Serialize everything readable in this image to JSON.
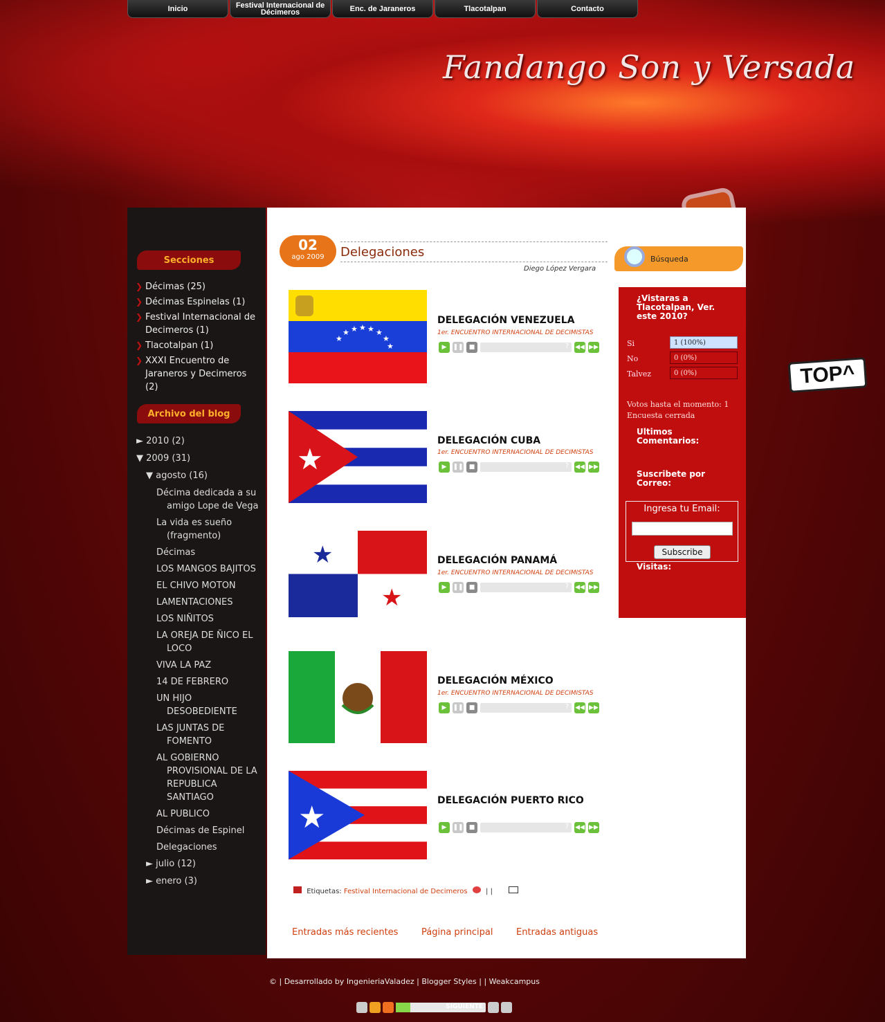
{
  "nav": {
    "items": [
      {
        "label": "Inicio"
      },
      {
        "label": "Festival Internacional de Décimeros"
      },
      {
        "label": "Enc. de Jaraneros"
      },
      {
        "label": "Tlacotalpan"
      },
      {
        "label": "Contacto"
      }
    ]
  },
  "header": {
    "site_title": "Fandango Son y Versada"
  },
  "sidebar": {
    "secciones_title": "Secciones",
    "secciones": [
      {
        "label": "Décimas (25)"
      },
      {
        "label": "Décimas Espinelas (1)"
      },
      {
        "label": "Festival Internacional de Decimeros (1)"
      },
      {
        "label": "Tlacotalpan (1)"
      },
      {
        "label": "XXXI Encuentro de Jaraneros y Decimeros (2)"
      }
    ],
    "archivo_title": "Archivo del blog",
    "archive": {
      "y2010": "► 2010 (2)",
      "y2009": "▼ 2009 (31)",
      "agosto": "▼ agosto (16)",
      "posts": [
        "Décima dedicada a su amigo Lope de Vega",
        "La vida es sueño (fragmento)",
        "Décimas",
        "LOS MANGOS BAJITOS",
        "EL CHIVO MOTON",
        "LAMENTACIONES",
        "LOS NIÑITOS",
        "LA OREJA DE ÑICO EL LOCO",
        "VIVA LA PAZ",
        "14 DE FEBRERO",
        "UN HIJO DESOBEDIENTE",
        "LAS JUNTAS DE FOMENTO",
        "AL GOBIERNO PROVISIONAL DE LA REPUBLICA SANTIAGO",
        "AL PUBLICO",
        "Décimas de Espinel",
        "Delegaciones"
      ],
      "julio": "► julio (12)",
      "enero": "► enero (3)"
    }
  },
  "post": {
    "date_day": "02",
    "date_month_year": "ago 2009",
    "title": "Delegaciones",
    "author": "Diego López Vergara",
    "delegations": [
      {
        "name": "DELEGACIÓN VENEZUELA",
        "subtitle": "1er. ENCUENTRO INTERNACIONAL DE DECIMISTAS"
      },
      {
        "name": "DELEGACIÓN CUBA",
        "subtitle": "1er. ENCUENTRO INTERNACIONAL DE DECIMISTAS"
      },
      {
        "name": "DELEGACIÓN PANAMÁ",
        "subtitle": "1er. ENCUENTRO INTERNACIONAL DE DECIMISTAS"
      },
      {
        "name": "DELEGACIÓN MÉXICO",
        "subtitle": "1er. ENCUENTRO INTERNACIONAL DE DECIMISTAS"
      },
      {
        "name": "DELEGACIÓN PUERTO RICO",
        "subtitle": ""
      }
    ],
    "player_unknown": "?",
    "labels_prefix": "Etiquetas:",
    "labels_link": "Festival Internacional de Decimeros",
    "labels_sep": "| |"
  },
  "pager": {
    "newer": "Entradas más recientes",
    "home": "Página principal",
    "older": "Entradas antiguas"
  },
  "right": {
    "search_label": "Búsqueda",
    "poll_question": "¿Vistaras a Tlacotalpan, Ver. este 2010?",
    "poll_options": [
      {
        "label": "Si",
        "result": "1 (100%)"
      },
      {
        "label": "No",
        "result": "0 (0%)"
      },
      {
        "label": "Talvez",
        "result": "0 (0%)"
      }
    ],
    "poll_votes": "Votos hasta el momento: 1",
    "poll_closed": "Encuesta cerrada",
    "ultimos": "Ultimos Comentarios:",
    "suscribete": "Suscribete por Correo:",
    "email_label": "Ingresa tu Email:",
    "subscribe_button": "Subscribe",
    "visitas": "Visitas:"
  },
  "top_button": "TOP^",
  "footer": {
    "text": "© | Desarrollado by IngenieriaValadez | Blogger Styles | | Weakcampus",
    "player_label": "SIGUIENTE"
  },
  "colors": {
    "accent_orange": "#e8741a",
    "dark_red": "#5a0a0a",
    "box_red": "#c00e0e",
    "link_orange": "#d04010"
  }
}
